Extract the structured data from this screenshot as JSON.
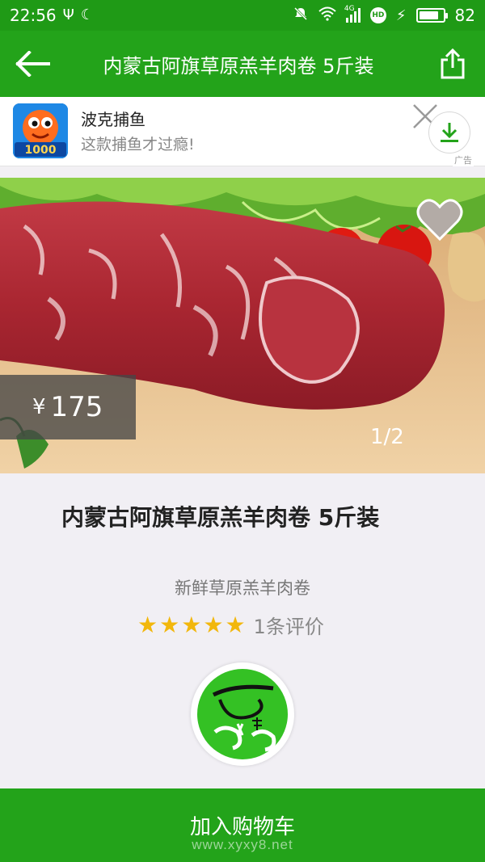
{
  "status_bar": {
    "time": "22:56",
    "network": "4G",
    "battery": "82",
    "battery_level": 0.82
  },
  "app_bar": {
    "title": "内蒙古阿旗草原羔羊肉卷 5斤装",
    "back_icon": "arrow-left-icon",
    "share_icon": "share-icon"
  },
  "ad": {
    "name": "波克捕鱼",
    "description": "这款捕鱼才过瘾!",
    "tag": "广告",
    "logo_text": "1000"
  },
  "product": {
    "price_symbol": "¥",
    "price": "175",
    "image_index": "1/2",
    "title": "内蒙古阿旗草原羔羊肉卷 5斤装",
    "subtitle": "新鲜草原羔羊肉卷",
    "rating": 5,
    "stars": [
      "★",
      "★",
      "★",
      "★",
      "★"
    ],
    "reviews": "1条评价"
  },
  "bottom_bar": {
    "add_to_cart": "加入购物车",
    "watermark": "www.xyxy8.net"
  },
  "colors": {
    "primary": "#23a31a",
    "status": "#1f9a16",
    "star": "#f2b70c"
  }
}
